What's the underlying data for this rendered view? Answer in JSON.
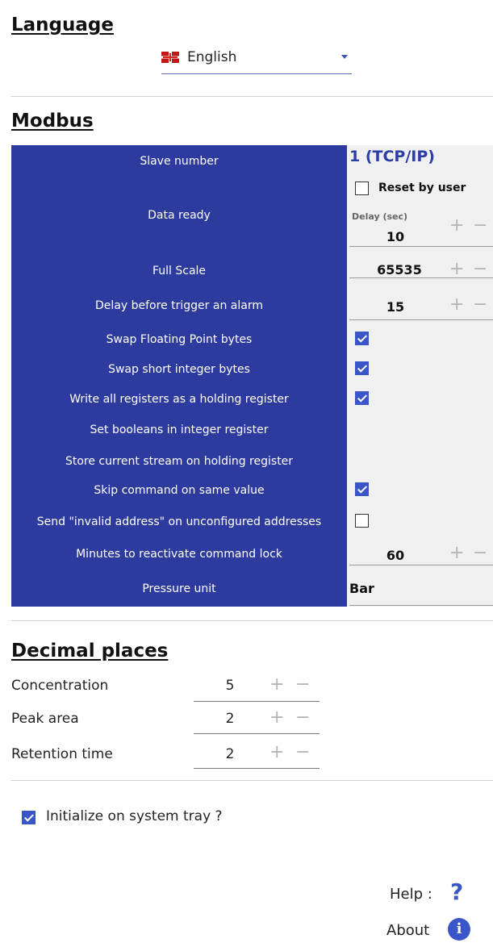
{
  "language": {
    "title": "Language",
    "selected": "English",
    "flag_icon": "uk-flag-icon"
  },
  "modbus": {
    "title": "Modbus",
    "label_bg": "#2e3b9e",
    "accent": "#3a55c7",
    "labels": {
      "slave_number": "Slave number",
      "data_ready": "Data ready",
      "full_scale": "Full Scale",
      "delay_alarm": "Delay before trigger an alarm",
      "swap_float": "Swap Floating Point bytes",
      "swap_short": "Swap short integer bytes",
      "write_holding": "Write all registers as a holding register",
      "set_booleans": "Set booleans in integer register",
      "store_stream": "Store current stream on holding register",
      "skip_command": "Skip command on same value",
      "invalid_address": "Send \"invalid address\" on unconfigured addresses",
      "minutes_reactivate": "Minutes to reactivate command lock",
      "pressure_unit": "Pressure unit"
    },
    "slave_number_value": "1 (TCP/IP)",
    "reset_by_user_label": "Reset by user",
    "reset_by_user_checked": false,
    "delay_label": "Delay (sec)",
    "delay_value": "10",
    "full_scale_value": "65535",
    "delay_alarm_value": "15",
    "swap_float_checked": true,
    "swap_short_checked": true,
    "write_holding_checked": true,
    "skip_command_checked": true,
    "invalid_address_checked": false,
    "minutes_reactivate_value": "60",
    "pressure_unit_value": "Bar"
  },
  "decimal_places": {
    "title": "Decimal places",
    "rows": [
      {
        "label": "Concentration",
        "value": "5"
      },
      {
        "label": "Peak area",
        "value": "2"
      },
      {
        "label": "Retention time",
        "value": "2"
      }
    ]
  },
  "tray": {
    "label": "Initialize on system tray ?",
    "checked": true
  },
  "footer": {
    "help_label": "Help :",
    "help_icon": "?",
    "about_label": "About",
    "about_icon": "i"
  },
  "stepper": {
    "plus": "+",
    "minus": "−"
  }
}
